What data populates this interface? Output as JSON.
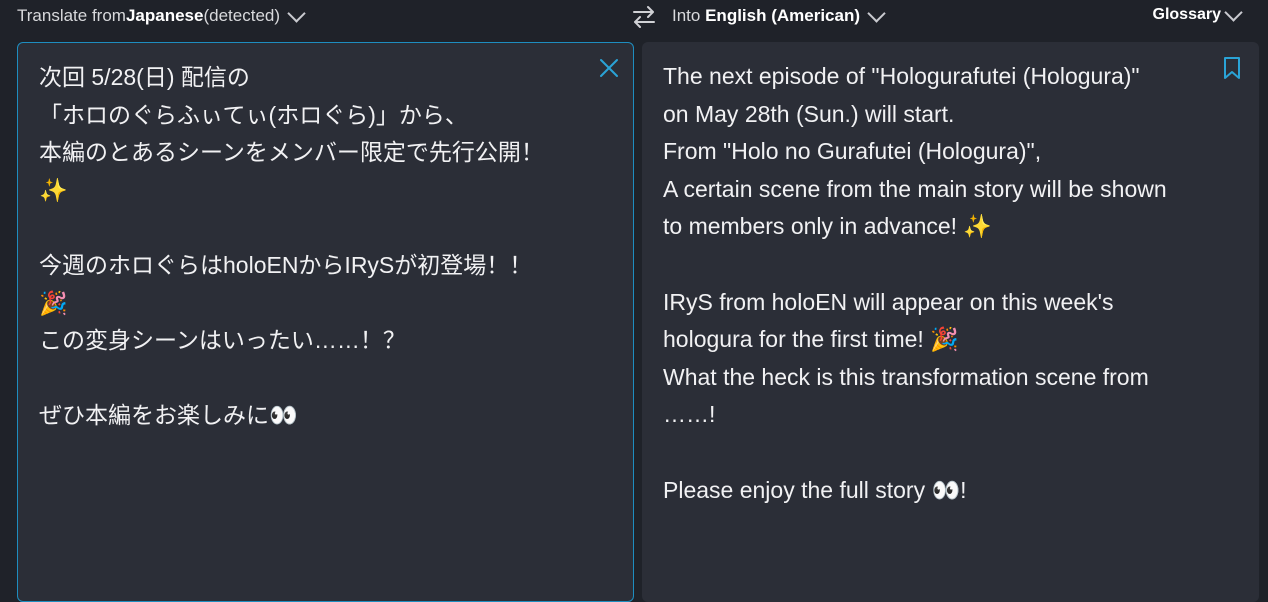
{
  "toolbar": {
    "source_prefix": "Translate from ",
    "source_language": "Japanese",
    "source_suffix": " (detected)",
    "target_prefix": "Into ",
    "target_language": "English (American)",
    "glossary_label": "Glossary",
    "swap_icon": "swap-arrows-icon"
  },
  "source": {
    "text": "次回 5/28(日) 配信の\n「ホロのぐらふぃてぃ(ホロぐら)」から、\n本編のとあるシーンをメンバー限定で先行公開！\n✨\n\n今週のホロぐらはholoENからIRySが初登場！！\n🎉\nこの変身シーンはいったい……！？\n\nぜひ本編をお楽しみに👀",
    "clear_icon": "close-icon"
  },
  "target": {
    "text": "The next episode of \"Hologurafutei (Hologura)\"\non May 28th (Sun.) will start.\nFrom \"Holo no Gurafutei (Hologura)\",\nA certain scene from the main story will be shown\nto members only in advance! ✨\n\nIRyS from holoEN will appear on this week's\nhologura for the first time! 🎉\nWhat the heck is this transformation scene from\n……!\n\nPlease enjoy the full story 👀!",
    "bookmark_icon": "bookmark-icon"
  },
  "colors": {
    "background": "#1f2229",
    "panel": "#2b2e37",
    "accent": "#1e8dbf",
    "text": "#f1f1f3"
  }
}
